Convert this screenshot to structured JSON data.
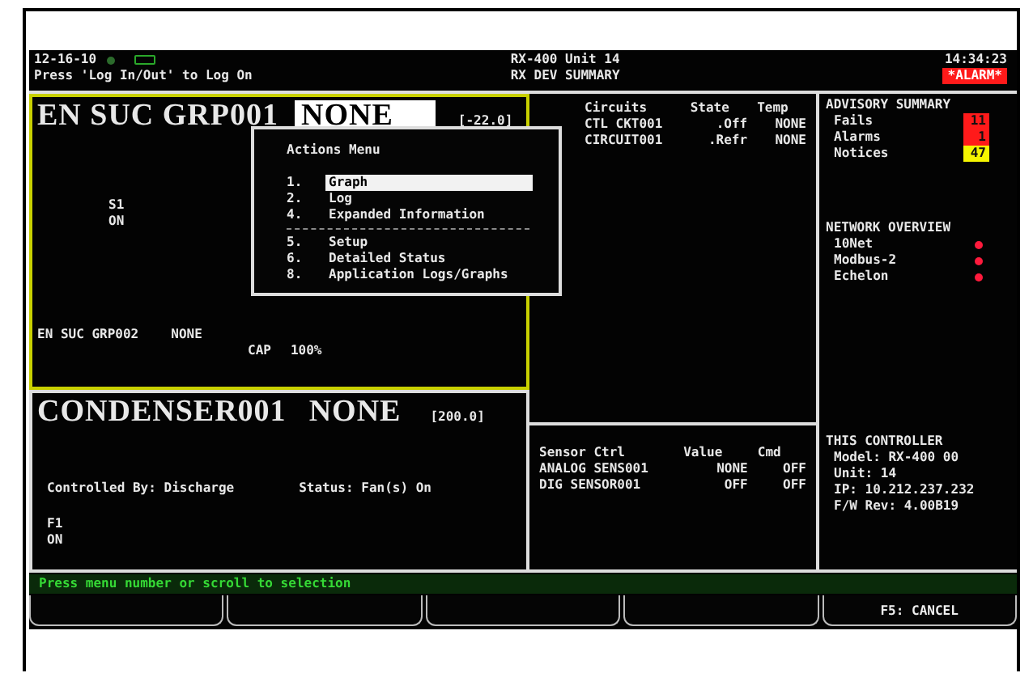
{
  "header": {
    "date": "12-16-10",
    "login_hint": "Press 'Log In/Out' to Log On",
    "unit": "RX-400 Unit 14",
    "screen": "RX DEV SUMMARY",
    "time": "14:34:23",
    "alarm": "*ALARM*"
  },
  "panels": [
    {
      "title": "EN SUC GRP001",
      "status": "NONE",
      "highlighted": true,
      "reading": "[-22.0]",
      "output_label": "S1",
      "output_state": "ON",
      "sub_row": {
        "name": "EN SUC GRP002",
        "status": "NONE",
        "cap_label": "CAP",
        "cap_value": "100%"
      }
    },
    {
      "title": "CONDENSER001",
      "status": "NONE",
      "highlighted": false,
      "reading": "[200.0]",
      "controlled_by": "Controlled By: Discharge",
      "status_text": "Status: Fan(s) On",
      "output_label": "F1",
      "output_state": "ON"
    }
  ],
  "circuits": {
    "columns": [
      "Circuits",
      "State",
      "Temp"
    ],
    "rows": [
      [
        "CTL CKT001",
        ".Off",
        "NONE"
      ],
      [
        "CIRCUIT001",
        ".Refr",
        "NONE"
      ]
    ]
  },
  "sensors": {
    "columns": [
      "Sensor Ctrl",
      "Value",
      "Cmd"
    ],
    "rows": [
      [
        "ANALOG SENS001",
        "NONE",
        "OFF"
      ],
      [
        "DIG SENSOR001",
        "OFF",
        "OFF"
      ]
    ]
  },
  "advisory": {
    "title": "ADVISORY SUMMARY",
    "items": [
      {
        "label": "Fails",
        "count": "11",
        "color": "#ff1a1a"
      },
      {
        "label": "Alarms",
        "count": "1",
        "color": "#ff1a1a"
      },
      {
        "label": "Notices",
        "count": "47",
        "color": "#f5f500"
      }
    ]
  },
  "network": {
    "title": "NETWORK OVERVIEW",
    "items": [
      {
        "label": "10Net",
        "color": "#ff1a3c"
      },
      {
        "label": "Modbus-2",
        "color": "#ff1a3c"
      },
      {
        "label": "Echelon",
        "color": "#ff1a3c"
      }
    ]
  },
  "controller": {
    "title": "THIS CONTROLLER",
    "lines": [
      "Model: RX-400  00",
      "Unit: 14",
      "IP: 10.212.237.232",
      "F/W Rev: 4.00B19"
    ]
  },
  "prompt": "Press menu number or scroll to selection",
  "function_keys": [
    {
      "kind": "blank"
    },
    {
      "kind": "blank"
    },
    {
      "kind": "blank"
    },
    {
      "kind": "blank"
    },
    {
      "kind": "labeled",
      "label": "F5: CANCEL"
    }
  ],
  "menu": {
    "title": "Actions Menu",
    "items": [
      {
        "kind": "item",
        "number": "1.",
        "label": "Graph",
        "selected": true
      },
      {
        "kind": "item",
        "number": "2.",
        "label": "Log",
        "selected": false
      },
      {
        "kind": "item",
        "number": "4.",
        "label": "Expanded Information",
        "selected": false
      },
      {
        "kind": "separator"
      },
      {
        "kind": "item",
        "number": "5.",
        "label": "Setup",
        "selected": false
      },
      {
        "kind": "item",
        "number": "6.",
        "label": "Detailed Status",
        "selected": false
      },
      {
        "kind": "item",
        "number": "8.",
        "label": "Application Logs/Graphs",
        "selected": false
      }
    ]
  }
}
